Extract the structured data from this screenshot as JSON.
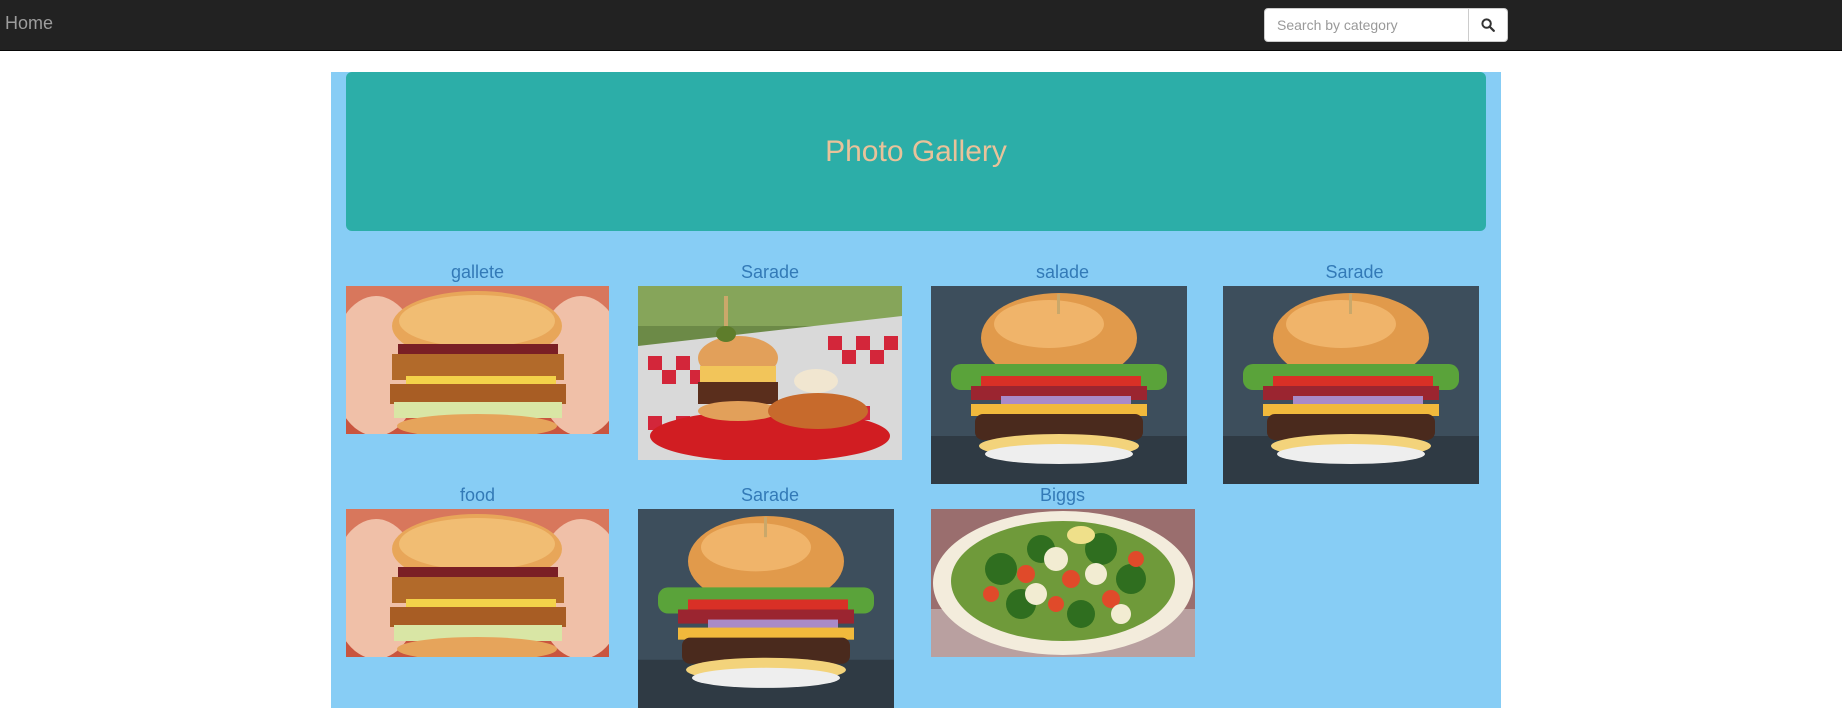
{
  "nav": {
    "home_label": "Home",
    "search_placeholder": "Search by category"
  },
  "jumbotron": {
    "title": "Photo Gallery"
  },
  "gallery": [
    {
      "caption": "gallete",
      "image": "chicken-burger-in-hands-photo"
    },
    {
      "caption": "Sarade",
      "image": "burger-in-checkered-basket-photo"
    },
    {
      "caption": "salade",
      "image": "bacon-cheeseburger-photo"
    },
    {
      "caption": "Sarade",
      "image": "bacon-cheeseburger-photo"
    },
    {
      "caption": "food",
      "image": "chicken-burger-in-hands-photo"
    },
    {
      "caption": "Sarade",
      "image": "bacon-cheeseburger-photo"
    },
    {
      "caption": "Biggs",
      "image": "vegetable-salad-bowl-photo"
    }
  ],
  "colors": {
    "navbar": "#222222",
    "container": "#87cdf5",
    "jumbotron": "#2caea8",
    "jumbotron_title": "#e9c29a",
    "caption_link": "#337ab7"
  }
}
